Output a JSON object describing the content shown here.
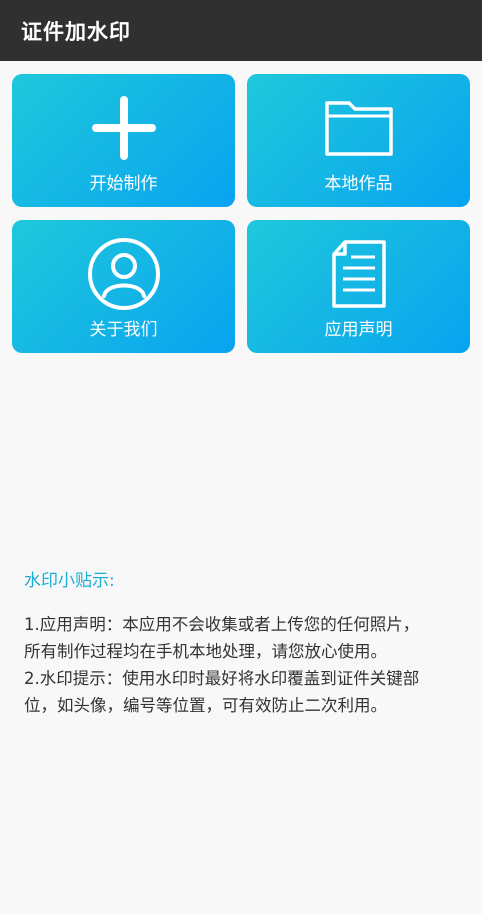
{
  "app": {
    "title": "证件加水印"
  },
  "tiles": [
    {
      "label": "开始制作",
      "icon": "plus-icon"
    },
    {
      "label": "本地作品",
      "icon": "folder-icon"
    },
    {
      "label": "关于我们",
      "icon": "user-circle-icon"
    },
    {
      "label": "应用声明",
      "icon": "document-icon"
    }
  ],
  "tips": {
    "title": "水印小贴示:",
    "lines": [
      "1.应用声明：本应用不会收集或者上传您的任何照片，",
      "所有制作过程均在手机本地处理，请您放心使用。",
      "2.水印提示：使用水印时最好将水印覆盖到证件关键部",
      "位，如头像，编号等位置，可有效防止二次利用。"
    ]
  },
  "colors": {
    "app_bar": "#303030",
    "tile_gradient_start": "#1ec8db",
    "tile_gradient_end": "#08a3f1",
    "tips_title": "#1aaed6",
    "background": "#f8f8f8"
  }
}
